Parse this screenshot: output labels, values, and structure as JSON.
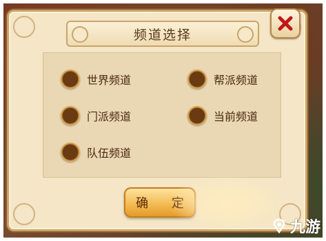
{
  "dialog": {
    "title": "频道选择",
    "confirm_label": "确 定"
  },
  "channels": [
    {
      "label": "世界频道"
    },
    {
      "label": "帮派频道"
    },
    {
      "label": "门派频道"
    },
    {
      "label": "当前频道"
    },
    {
      "label": "队伍频道"
    }
  ],
  "watermark": {
    "text": "九游"
  },
  "icons": {
    "close": "close-x-icon",
    "radio": "radio-button"
  },
  "colors": {
    "panel": "#f4e6c6",
    "radio_center": "#6a3a12",
    "close_x": "#c0161a",
    "confirm": "#f2b850"
  }
}
